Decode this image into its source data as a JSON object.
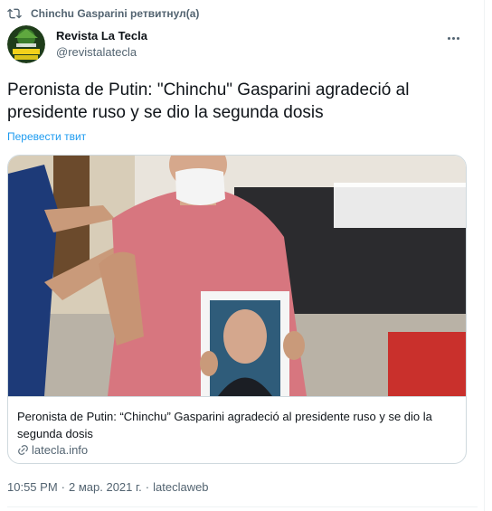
{
  "retweet": {
    "icon": "retweet-icon",
    "text": "Chinchu Gasparini ретвитнул(а)"
  },
  "author": {
    "name": "Revista La Tecla",
    "handle": "@revistalatecla",
    "avatar_icon": "avatar-logo"
  },
  "tweet": {
    "text": "Peronista de Putin: \"Chinchu\" Gasparini agradeció al presidente ruso y se dio la segunda dosis",
    "translate_label": "Перевести твит"
  },
  "card": {
    "title": "Peronista de Putin: “Chinchu” Gasparini agradeció al presidente ruso y se dio la segunda dosis",
    "domain": "latecla.info",
    "link_icon": "link-icon"
  },
  "meta": {
    "time": "10:55 PM",
    "date": "2 мар. 2021 г.",
    "source": "lateclaweb",
    "separator": "·"
  },
  "colors": {
    "accent": "#1d9bf0",
    "secondary_text": "#536471",
    "border": "#cfd9de"
  }
}
